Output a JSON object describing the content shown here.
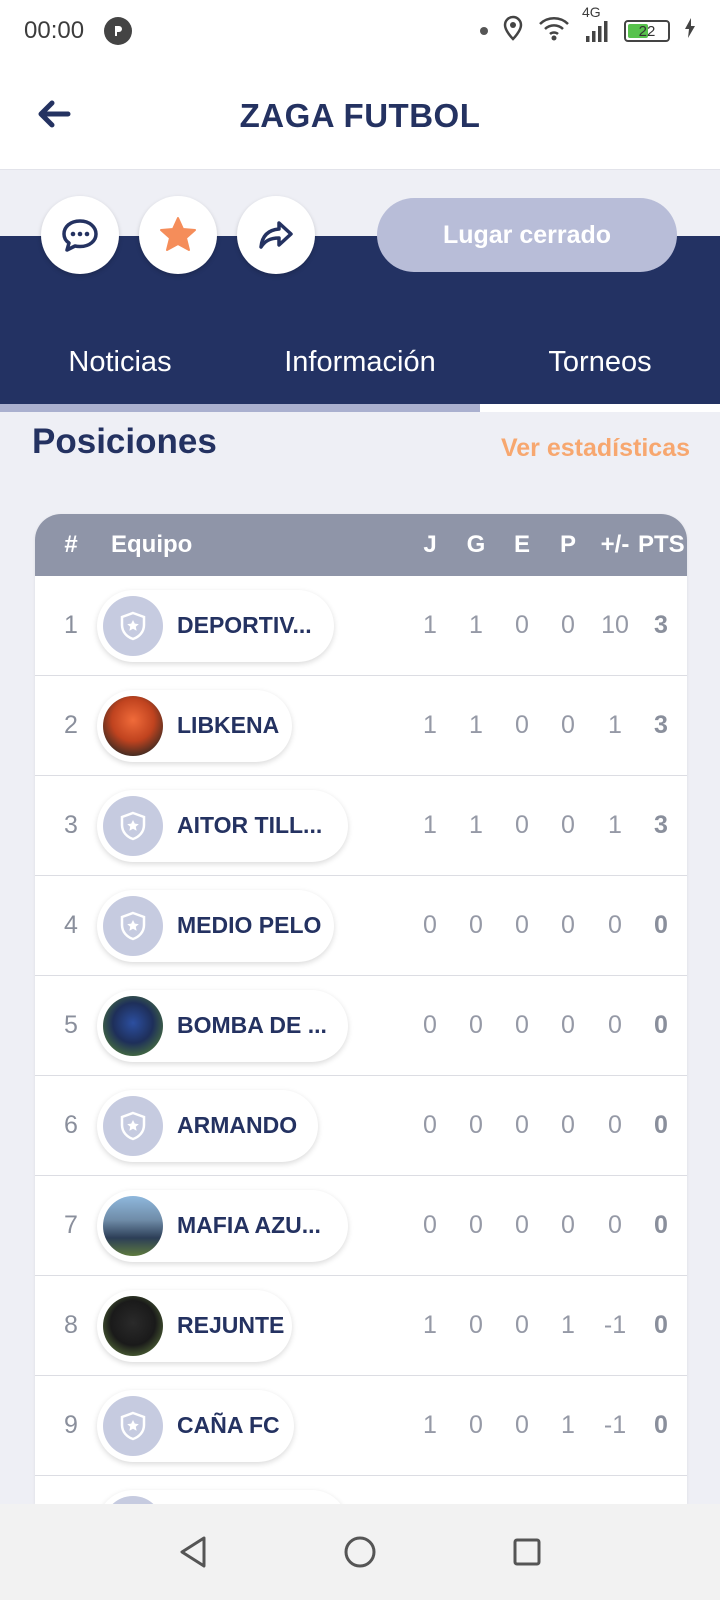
{
  "status_bar": {
    "time": "00:00",
    "network": "4G",
    "battery": "22"
  },
  "header": {
    "title": "ZAGA FUTBOL",
    "back_icon": "arrow-left-icon"
  },
  "actions": {
    "chat_icon": "chat-bubble-icon",
    "favorite_icon": "star-icon",
    "share_icon": "share-arrow-icon",
    "status_label": "Lugar cerrado"
  },
  "tabs": [
    {
      "label": "Noticias"
    },
    {
      "label": "Información"
    },
    {
      "label": "Torneos"
    }
  ],
  "positions": {
    "title": "Posiciones",
    "stats_link": "Ver estadísticas",
    "headers": {
      "rank": "#",
      "team": "Equipo",
      "j": "J",
      "g": "G",
      "e": "E",
      "p": "P",
      "diff": "+/-",
      "pts": "PTS"
    },
    "rows": [
      {
        "rank": "1",
        "team": "DEPORTIV...",
        "j": "1",
        "g": "1",
        "e": "0",
        "p": "0",
        "diff": "10",
        "pts": "3"
      },
      {
        "rank": "2",
        "team": "LIBKENA",
        "j": "1",
        "g": "1",
        "e": "0",
        "p": "0",
        "diff": "1",
        "pts": "3"
      },
      {
        "rank": "3",
        "team": "AITOR TILL...",
        "j": "1",
        "g": "1",
        "e": "0",
        "p": "0",
        "diff": "1",
        "pts": "3"
      },
      {
        "rank": "4",
        "team": "MEDIO PELO",
        "j": "0",
        "g": "0",
        "e": "0",
        "p": "0",
        "diff": "0",
        "pts": "0"
      },
      {
        "rank": "5",
        "team": "BOMBA DE ...",
        "j": "0",
        "g": "0",
        "e": "0",
        "p": "0",
        "diff": "0",
        "pts": "0"
      },
      {
        "rank": "6",
        "team": "ARMANDO",
        "j": "0",
        "g": "0",
        "e": "0",
        "p": "0",
        "diff": "0",
        "pts": "0"
      },
      {
        "rank": "7",
        "team": "MAFIA AZU...",
        "j": "0",
        "g": "0",
        "e": "0",
        "p": "0",
        "diff": "0",
        "pts": "0"
      },
      {
        "rank": "8",
        "team": "REJUNTE",
        "j": "1",
        "g": "0",
        "e": "0",
        "p": "1",
        "diff": "-1",
        "pts": "0"
      },
      {
        "rank": "9",
        "team": "CAÑA FC",
        "j": "1",
        "g": "0",
        "e": "0",
        "p": "1",
        "diff": "-1",
        "pts": "0"
      }
    ]
  },
  "colors": {
    "primary": "#233263",
    "accent": "#f7a76f",
    "pill_disabled": "#b8bdd8"
  }
}
